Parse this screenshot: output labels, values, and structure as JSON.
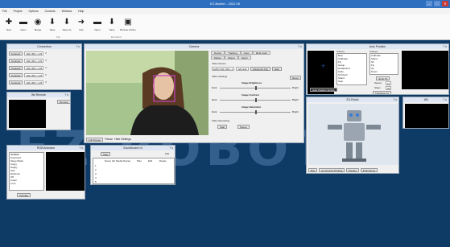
{
  "app": {
    "title": "EZ-Builder - 2022.05"
  },
  "menu": [
    "File",
    "Project",
    "Options",
    "Controls",
    "Window",
    "Help"
  ],
  "toolbar": {
    "buttons": [
      "New",
      "Open",
      "Merge",
      "Save",
      "Save As",
      "Exit",
      "Open",
      "Save",
      "Browse Online"
    ],
    "groups": [
      "File",
      "EZ-Cloud"
    ]
  },
  "watermark": "EZ-ROBOT",
  "connection": {
    "title": "Connection",
    "rows": [
      {
        "button": "Connect",
        "ip": "192.168.1.1:23"
      },
      {
        "button": "Connect",
        "ip": "192.168.1.1:23"
      },
      {
        "button": "Connect",
        "ip": "192.168.1.1:23"
      },
      {
        "button": "Connect",
        "ip": "192.168.1.1:23"
      },
      {
        "button": "Connect",
        "ip": "192.168.1.1:23"
      }
    ]
  },
  "wii": {
    "title": "Wii Remote",
    "button": "Remote"
  },
  "camera": {
    "title": "Camera",
    "tabs": [
      "Device",
      "Tracking",
      "Color",
      "Multi Color",
      "Motion",
      "Object",
      "Glyph"
    ],
    "videoDevice": "Video Device",
    "deviceValue": "EZB://192.168.1.1",
    "resolution": "320x240",
    "advancedButton": "Advanced Cfg",
    "startButton": "Start",
    "videoSettings": "Video Settings",
    "resetButton": "Reset",
    "brightness": "Image Brightness",
    "contrast": "Image Contrast",
    "saturation": "Image Saturation",
    "darkLabel": "Dark",
    "brightLabel": "Bright",
    "videoRecording": "Video Recording",
    "recStart": "Start",
    "recPause": "Pause",
    "fullScreen": "Full Screen",
    "pauseCheck": "Pause",
    "hideSettings": "Hide Settings",
    "colors": {
      "faceBox": "#c040c0"
    }
  },
  "autoPosition": {
    "title": "Auto Position",
    "actionsLabel": "Actions",
    "framesLabel": "Frames",
    "actions": [
      "Bow",
      "Calibrate",
      "Fly",
      "Getup",
      "Headstand",
      "Hello",
      "Sit Down",
      "Stand",
      "Stop",
      "Walk"
    ],
    "frames": [
      "Calibrate",
      "Stand",
      "Sit",
      "Fly",
      "Up",
      "Down",
      "Walk 1"
    ],
    "buttons": [
      "Stop",
      "Jump To",
      "Speed",
      "Steps"
    ],
    "speed": "10",
    "steps": "20",
    "scriptButton": "Auto Position Scripts",
    "transitionButton": "Transition To"
  },
  "ezRobot": {
    "title": "EZ-Robot",
    "buttons": [
      "Buy",
      "Community Printing",
      "Design",
      "Instructions"
    ]
  },
  "wii2": {
    "title": "Wii"
  },
  "rgbAnimator": {
    "title": "RGB Animator",
    "listLabel": "Actions",
    "items": [
      "Surprised",
      "Sleep Mode",
      "Angry",
      "Happy",
      "Sad",
      "Rainbow",
      "Off",
      "Listen",
      "Love"
    ],
    "button": "Animate"
  },
  "soundboard": {
    "title": "Soundboard v4",
    "stopButton": "Stop",
    "volume": "100",
    "columns": [
      "",
      "Name (for Media Name)",
      "Play",
      "Edit",
      "Delete"
    ],
    "rowNumbers": [
      "1",
      "2",
      "3",
      "4",
      "5"
    ]
  }
}
